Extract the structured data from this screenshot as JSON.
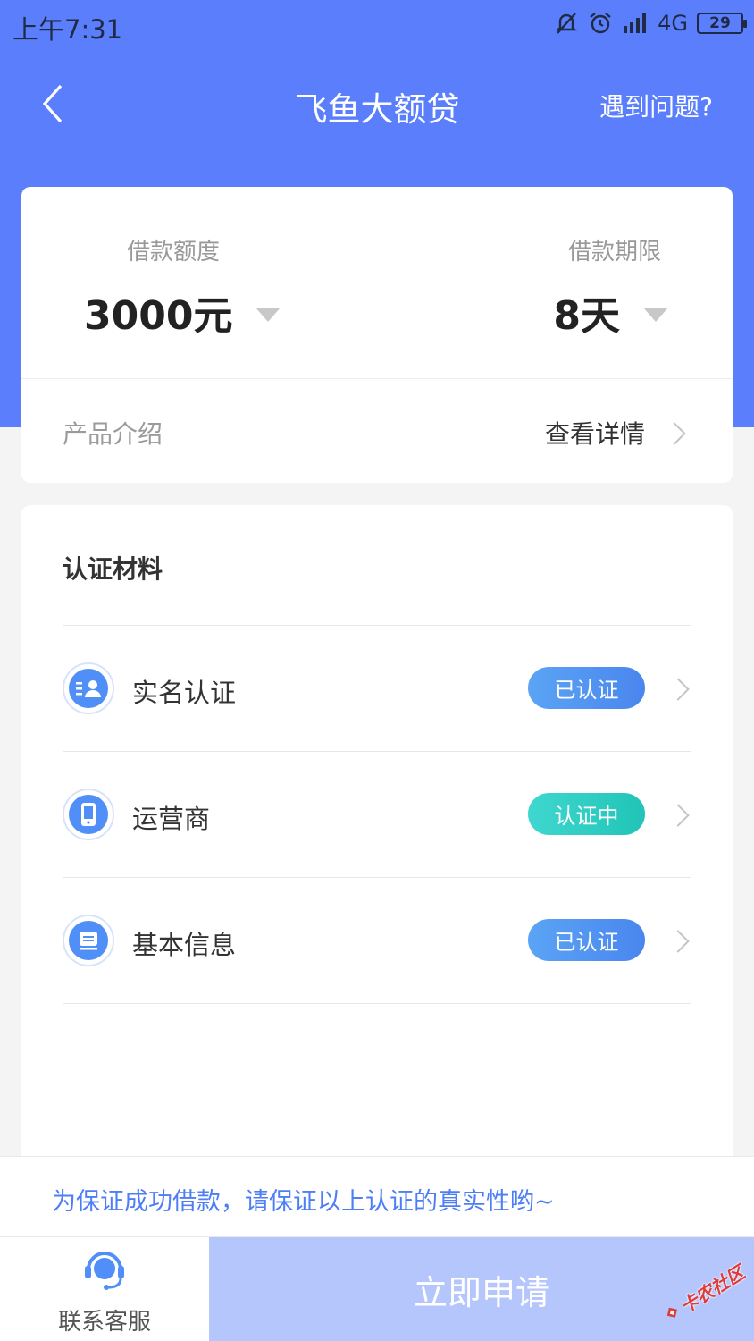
{
  "status_bar": {
    "time": "上午7:31",
    "network": "4G",
    "battery": "29"
  },
  "nav": {
    "title": "飞鱼大额贷",
    "help": "遇到问题?"
  },
  "loan": {
    "amount_label": "借款额度",
    "amount_value": "3000元",
    "term_label": "借款期限",
    "term_value": "8天",
    "intro_label": "产品介绍",
    "intro_link": "查看详情"
  },
  "cert": {
    "title": "认证材料",
    "items": [
      {
        "name": "实名认证",
        "status": "已认证",
        "icon": "id-card-icon"
      },
      {
        "name": "运营商",
        "status": "认证中",
        "icon": "phone-icon"
      },
      {
        "name": "基本信息",
        "status": "已认证",
        "icon": "info-card-icon"
      }
    ]
  },
  "tip": "为保证成功借款，请保证以上认证的真实性哟~",
  "bottom": {
    "service_label": "联系客服",
    "apply_label": "立即申请"
  },
  "watermark": "卡农社区",
  "colors": {
    "primary": "#5b7ffc",
    "verified": "#4f8ff7",
    "pending": "#21c4b7",
    "apply_bg": "#b4c6fc",
    "tip": "#4d7ef6"
  }
}
